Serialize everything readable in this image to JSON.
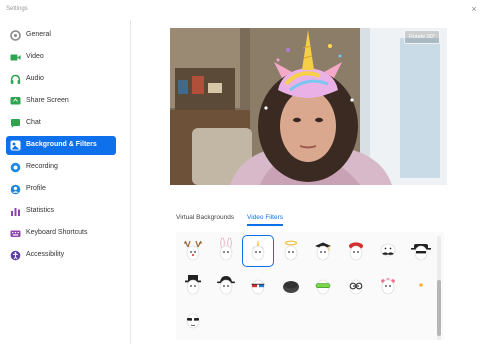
{
  "window": {
    "title": "Settings",
    "close_glyph": "×"
  },
  "sidebar": {
    "items": [
      {
        "key": "general",
        "label": "General",
        "icon": "gear-icon",
        "color": "#8a8a8a",
        "active": false
      },
      {
        "key": "video",
        "label": "Video",
        "icon": "video-camera-icon",
        "color": "#2ea44f",
        "active": false
      },
      {
        "key": "audio",
        "label": "Audio",
        "icon": "headphones-icon",
        "color": "#2ea44f",
        "active": false
      },
      {
        "key": "share-screen",
        "label": "Share Screen",
        "icon": "share-screen-icon",
        "color": "#2ea44f",
        "active": false
      },
      {
        "key": "chat",
        "label": "Chat",
        "icon": "chat-bubble-icon",
        "color": "#2ea44f",
        "active": false
      },
      {
        "key": "background-filters",
        "label": "Background & Filters",
        "icon": "background-icon",
        "color": "#ffffff",
        "active": true
      },
      {
        "key": "recording",
        "label": "Recording",
        "icon": "record-icon",
        "color": "#1e88e5",
        "active": false
      },
      {
        "key": "profile",
        "label": "Profile",
        "icon": "profile-icon",
        "color": "#1e88e5",
        "active": false
      },
      {
        "key": "statistics",
        "label": "Statistics",
        "icon": "statistics-icon",
        "color": "#8e44ad",
        "active": false
      },
      {
        "key": "keyboard-shortcuts",
        "label": "Keyboard Shortcuts",
        "icon": "keyboard-icon",
        "color": "#8e44ad",
        "active": false
      },
      {
        "key": "accessibility",
        "label": "Accessibility",
        "icon": "accessibility-icon",
        "color": "#5b3fa8",
        "active": false
      }
    ]
  },
  "preview": {
    "mirror_button": "Rotate 90°"
  },
  "tabs": [
    {
      "label": "Virtual Backgrounds",
      "active": false
    },
    {
      "label": "Video Filters",
      "active": true
    }
  ],
  "filters": [
    {
      "name": "deer-antlers-filter",
      "selected": false
    },
    {
      "name": "bunny-ears-filter",
      "selected": false
    },
    {
      "name": "unicorn-filter",
      "selected": true
    },
    {
      "name": "halo-filter",
      "selected": false
    },
    {
      "name": "graduation-cap-filter",
      "selected": false
    },
    {
      "name": "red-beret-filter",
      "selected": false
    },
    {
      "name": "mustache-filter",
      "selected": false
    },
    {
      "name": "bandit-hat-filter",
      "selected": false
    },
    {
      "name": "top-hat-filter",
      "selected": false
    },
    {
      "name": "fedora-filter",
      "selected": false
    },
    {
      "name": "3d-glasses-filter",
      "selected": false
    },
    {
      "name": "dark-hat-filter",
      "selected": false
    },
    {
      "name": "ski-goggles-filter",
      "selected": false
    },
    {
      "name": "round-glasses-filter",
      "selected": false
    },
    {
      "name": "flower-crown-filter",
      "selected": false
    },
    {
      "name": "sparkle-filter",
      "selected": false
    },
    {
      "name": "sunglasses-filter",
      "selected": false
    }
  ],
  "colors": {
    "accent": "#0e71eb"
  }
}
